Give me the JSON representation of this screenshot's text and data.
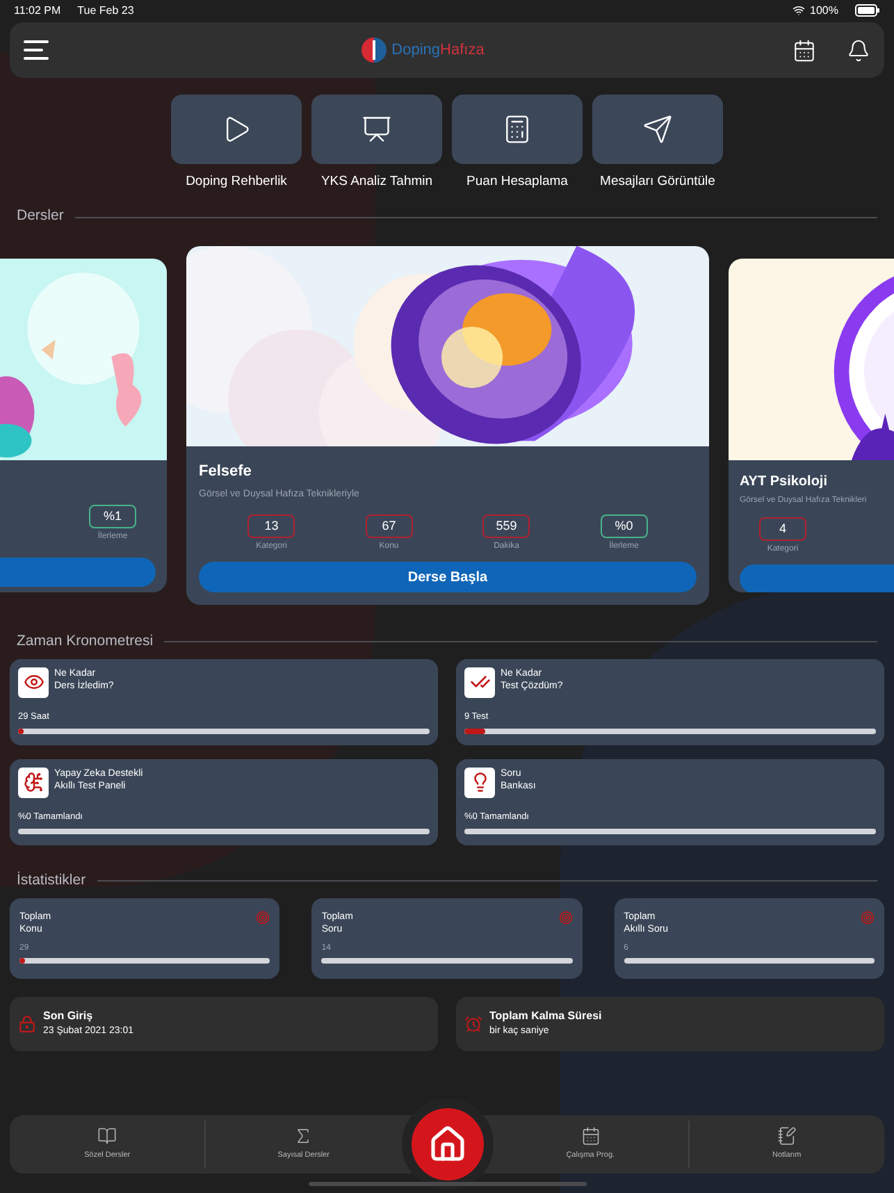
{
  "status_bar": {
    "time": "11:02 PM",
    "date": "Tue Feb 23",
    "battery": "100%"
  },
  "header": {
    "logo": {
      "first": "Doping",
      "second": "Hafıza"
    }
  },
  "quick_actions": [
    {
      "label": "Doping Rehberlik",
      "kind": "play"
    },
    {
      "label": "YKS Analiz Tahmin",
      "kind": "chart"
    },
    {
      "label": "Puan Hesaplama",
      "kind": "calculator"
    },
    {
      "label": "Mesajları Görüntüle",
      "kind": "send"
    }
  ],
  "courses_section": {
    "title": "Dersler"
  },
  "courses": [
    {
      "kind": "partial_left",
      "stats": [
        {
          "value": "%1",
          "label": "İlerleme",
          "kind": "progress"
        }
      ]
    },
    {
      "kind": "full",
      "title": "Felsefe",
      "subtitle": "Görsel ve Duysal Hafıza Teknikleriyle",
      "stats": [
        {
          "value": "13",
          "label": "Kategori",
          "kind": "count"
        },
        {
          "value": "67",
          "label": "Konu",
          "kind": "count"
        },
        {
          "value": "559",
          "label": "Dakika",
          "kind": "count"
        },
        {
          "value": "%0",
          "label": "İlerleme",
          "kind": "progress"
        }
      ],
      "button": "Derse Başla"
    },
    {
      "kind": "partial_right",
      "title": "AYT Psikoloji",
      "subtitle": "Görsel ve Duysal Hafıza Teknikleri",
      "stats": [
        {
          "value": "4",
          "label": "Kategori",
          "kind": "count"
        }
      ]
    }
  ],
  "timer_section": {
    "title": "Zaman Kronometresi"
  },
  "timers": [
    {
      "kind": "eye",
      "title": "Ne Kadar\nDers İzledim?",
      "reading": "29 Saat",
      "level": 0.01
    },
    {
      "kind": "check",
      "title": "Ne Kadar\nTest Çözdüm?",
      "reading": "9 Test",
      "level": 0.05
    },
    {
      "kind": "brain",
      "title": "Yapay Zeka Destekli\nAkıllı Test Paneli",
      "reading": "%0 Tamamlandı",
      "level": 0
    },
    {
      "kind": "bulb",
      "title": "Soru\nBankası",
      "reading": "%0 Tamamlandı",
      "level": 0
    }
  ],
  "stats_section": {
    "title": "İstatistikler"
  },
  "stats": [
    {
      "title": "Toplam\nKonu",
      "reading": "29",
      "level": 0.01
    },
    {
      "title": "Toplam\nSoru",
      "reading": "14"
    },
    {
      "title": "Toplam\nAkıllı Soru",
      "reading": "6"
    }
  ],
  "info": [
    {
      "kind": "lock",
      "title": "Son Giriş",
      "value": "23 Şubat 2021 23:01"
    },
    {
      "kind": "timer",
      "title": "Toplam Kalma Süresi",
      "value": "bir kaç saniye"
    }
  ],
  "bottom_nav": [
    {
      "label": "Sözel Dersler",
      "kind": "book"
    },
    {
      "label": "Sayısal Dersler",
      "kind": "math"
    },
    {
      "kind": "home"
    },
    {
      "label": "Çalışma Prog.",
      "kind": "calendar"
    },
    {
      "label": "Notlarım",
      "kind": "notes"
    }
  ]
}
